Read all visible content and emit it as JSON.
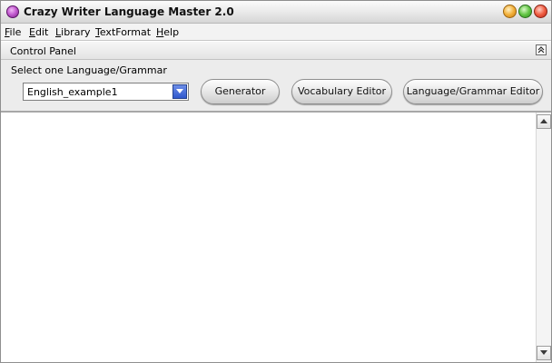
{
  "window": {
    "title": "Crazy Writer Language Master 2.0"
  },
  "menu": {
    "file": "File",
    "edit": "Edit",
    "library": "Library",
    "textformat": "TextFormat",
    "help": "Help"
  },
  "control_panel": {
    "title": "Control Panel",
    "select_label": "Select one Language/Grammar",
    "selected_grammar": "English_example1",
    "buttons": {
      "generator": "Generator",
      "vocabulary_editor": "Vocabulary Editor",
      "grammar_editor": "Language/Grammar Editor"
    }
  },
  "icons": {
    "app": "app-icon",
    "minimize": "minimize-icon",
    "maximize": "maximize-icon",
    "close": "close-icon",
    "collapse": "collapse-up-icon",
    "dropdown": "chevron-down-icon",
    "scroll_up": "arrow-up-icon",
    "scroll_down": "arrow-down-icon"
  },
  "colors": {
    "minimize": "#f2b03a",
    "maximize": "#63c645",
    "close": "#ef5d42",
    "app_icon": "#c65fd3",
    "dropdown_arrow": "#2f57cc"
  },
  "editor": {
    "content": ""
  }
}
